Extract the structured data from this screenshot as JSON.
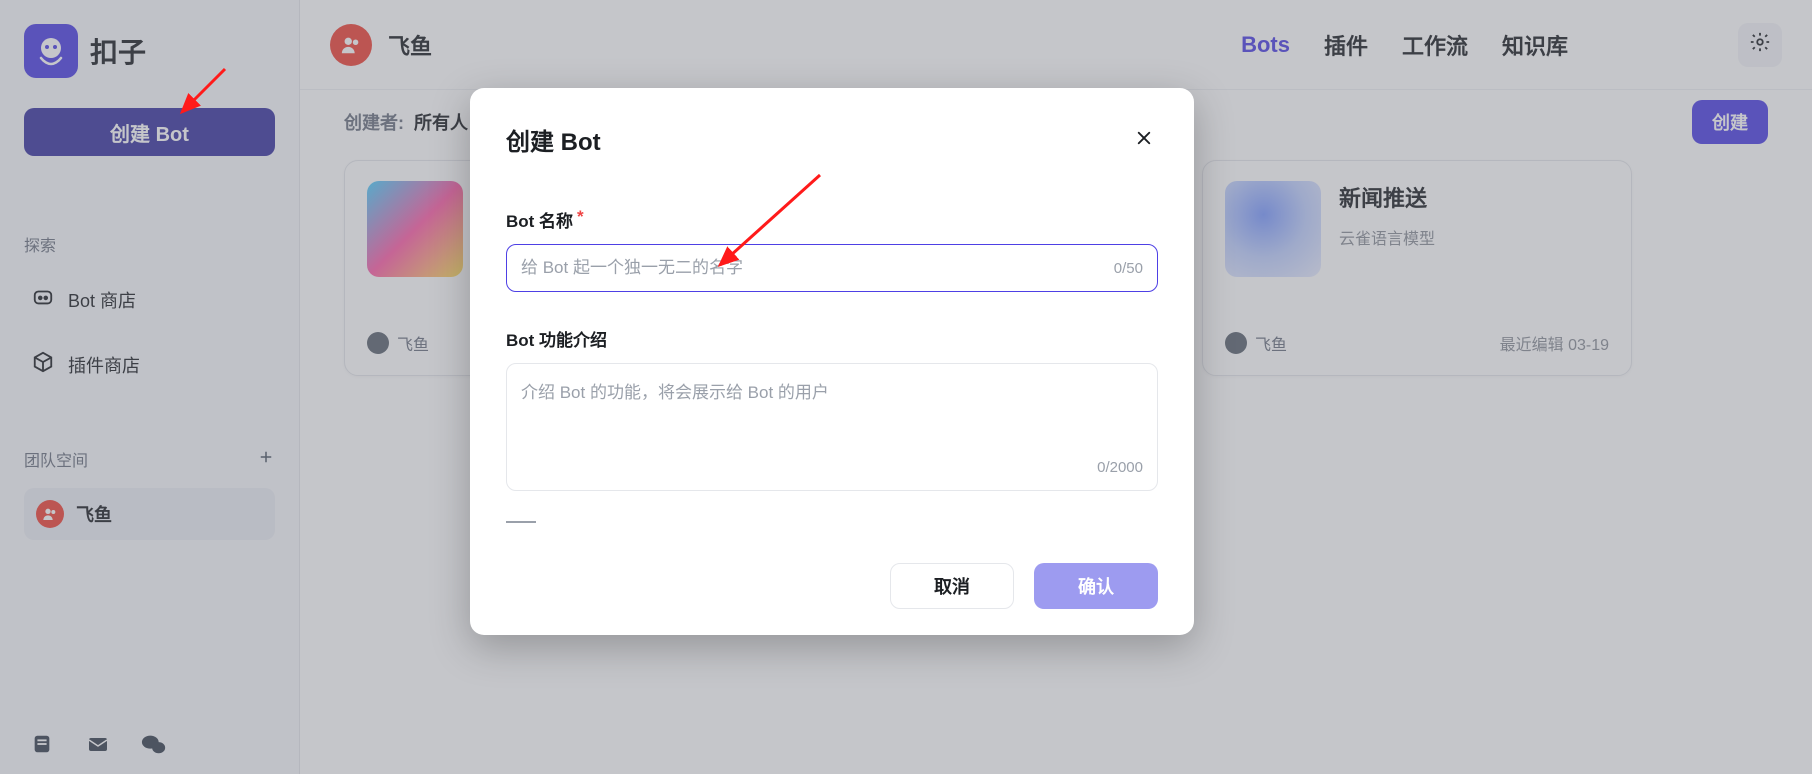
{
  "sidebar": {
    "brand": "扣子",
    "create_bot_label": "创建 Bot",
    "explore_label": "探索",
    "nav": {
      "bot_store": "Bot 商店",
      "plugin_store": "插件商店"
    },
    "team_label": "团队空间",
    "teams": [
      {
        "name": "飞鱼"
      }
    ]
  },
  "topbar": {
    "workspace_name": "飞鱼",
    "tabs": {
      "bots": "Bots",
      "plugins": "插件",
      "workflows": "工作流",
      "knowledge": "知识库"
    }
  },
  "filter": {
    "creator_label": "创建者:",
    "creator_value": "所有人",
    "create_button": "创建"
  },
  "cards": [
    {
      "title": "新闻推送",
      "model": "云雀语言模型",
      "owner": "飞鱼",
      "last_edit": "最近编辑 03-19"
    }
  ],
  "partial_card_owner": "飞鱼",
  "modal": {
    "title": "创建 Bot",
    "name_label": "Bot 名称",
    "name_placeholder": "给 Bot 起一个独一无二的名字",
    "name_counter": "0/50",
    "desc_label": "Bot 功能介绍",
    "desc_placeholder": "介绍 Bot 的功能，将会展示给 Bot 的用户",
    "desc_counter": "0/2000",
    "cancel": "取消",
    "confirm": "确认"
  }
}
